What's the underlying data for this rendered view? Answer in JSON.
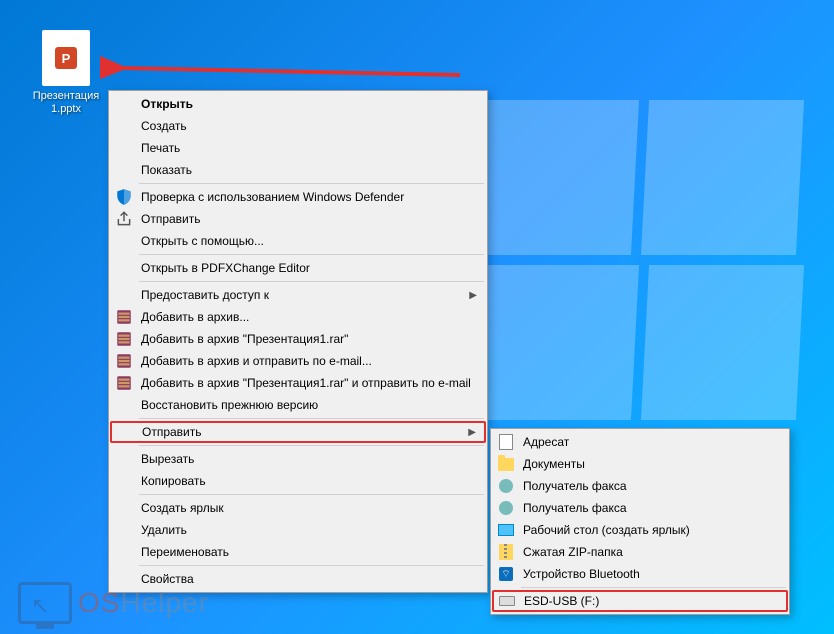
{
  "desktop_icon": {
    "file_name": "Презентация 1.pptx",
    "app_badge": "P"
  },
  "context_menu": {
    "items": [
      {
        "label": "Открыть",
        "bold": true
      },
      {
        "label": "Создать"
      },
      {
        "label": "Печать"
      },
      {
        "label": "Показать"
      },
      {
        "sep": true
      },
      {
        "label": "Проверка с использованием Windows Defender",
        "icon": "shield"
      },
      {
        "label": "Отправить",
        "icon": "share"
      },
      {
        "label": "Открыть с помощью..."
      },
      {
        "sep": true
      },
      {
        "label": "Открыть в PDFXChange Editor"
      },
      {
        "sep": true
      },
      {
        "label": "Предоставить доступ к",
        "submenu": true
      },
      {
        "label": "Добавить в архив...",
        "icon": "rar"
      },
      {
        "label": "Добавить в архив \"Презентация1.rar\"",
        "icon": "rar"
      },
      {
        "label": "Добавить в архив и отправить по e-mail...",
        "icon": "rar"
      },
      {
        "label": "Добавить в архив \"Презентация1.rar\" и отправить по e-mail",
        "icon": "rar"
      },
      {
        "label": "Восстановить прежнюю версию"
      },
      {
        "sep": true
      },
      {
        "label": "Отправить",
        "submenu": true,
        "highlighted": true
      },
      {
        "sep": true
      },
      {
        "label": "Вырезать"
      },
      {
        "label": "Копировать"
      },
      {
        "sep": true
      },
      {
        "label": "Создать ярлык"
      },
      {
        "label": "Удалить"
      },
      {
        "label": "Переименовать"
      },
      {
        "sep": true
      },
      {
        "label": "Свойства"
      }
    ]
  },
  "send_to_submenu": {
    "items": [
      {
        "label": "Адресат",
        "icon": "addr"
      },
      {
        "label": "Документы",
        "icon": "folder"
      },
      {
        "label": "Получатель факса",
        "icon": "person"
      },
      {
        "label": "Получатель факса",
        "icon": "person"
      },
      {
        "label": "Рабочий стол (создать ярлык)",
        "icon": "desk"
      },
      {
        "label": "Сжатая ZIP-папка",
        "icon": "zip"
      },
      {
        "label": "Устройство Bluetooth",
        "icon": "bt"
      },
      {
        "sep": true
      },
      {
        "label": "ESD-USB (F:)",
        "icon": "drive",
        "highlighted": true
      }
    ]
  },
  "watermark": {
    "os": "OS",
    "helper": "Helper"
  }
}
